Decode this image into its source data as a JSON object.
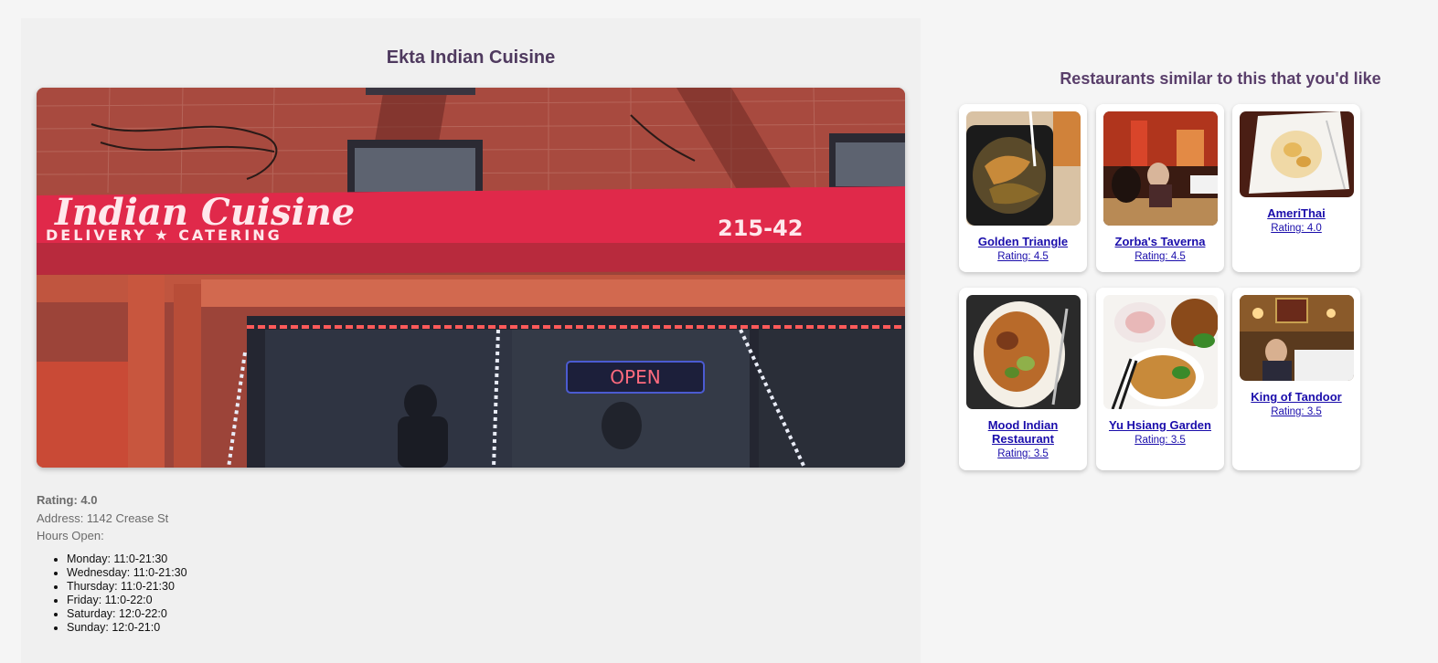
{
  "restaurant": {
    "name": "Ekta Indian Cuisine",
    "rating_text": "Rating: 4.0",
    "address_text": "Address: 1142 Crease St",
    "hours_label": "Hours Open:",
    "hours": [
      "Monday: 11:0-21:30",
      "Wednesday: 11:0-21:30",
      "Thursday: 11:0-21:30",
      "Friday: 11:0-22:0",
      "Saturday: 12:0-22:0",
      "Sunday: 12:0-21:0"
    ],
    "photo": {
      "awning_text": "Indian Cuisine",
      "awning_subtext": "DELIVERY ★ CATERING",
      "awning_phone": "215-42",
      "sign_text": "OPEN"
    }
  },
  "similar": {
    "title": "Restaurants similar to this that you'd like",
    "items": [
      {
        "name": "Golden Triangle",
        "rating": "Rating: 4.5"
      },
      {
        "name": "Zorba's Taverna",
        "rating": "Rating: 4.5"
      },
      {
        "name": "AmeriThai",
        "rating": "Rating: 4.0"
      },
      {
        "name": "Mood Indian Restaurant",
        "rating": "Rating: 3.5"
      },
      {
        "name": "Yu Hsiang Garden",
        "rating": "Rating: 3.5"
      },
      {
        "name": "King of Tandoor",
        "rating": "Rating: 3.5"
      }
    ]
  },
  "colors": {
    "title": "#4f3a5f",
    "link": "#1a0dab",
    "awning": "#e0294a",
    "brick": "#a5473c"
  }
}
